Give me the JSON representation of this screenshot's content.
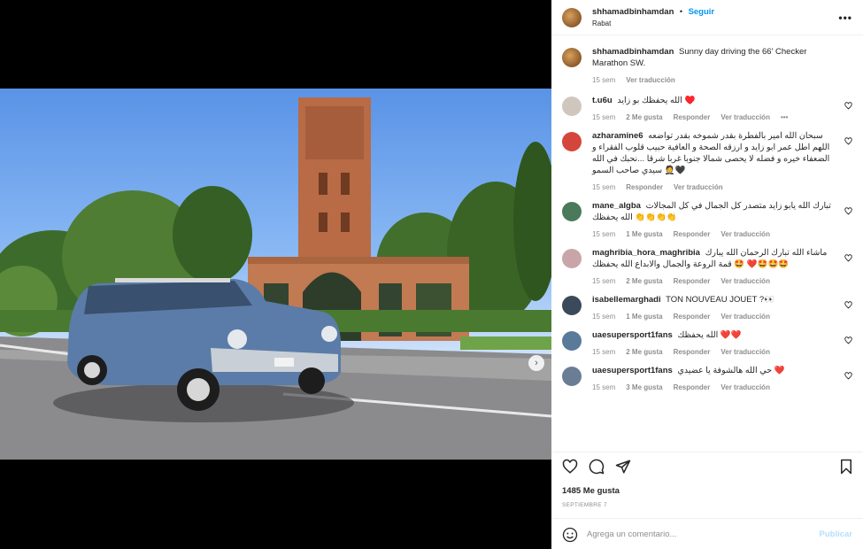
{
  "post": {
    "username": "shhamadbinhamdan",
    "separator": "•",
    "follow_label": "Seguir",
    "location": "Rabat",
    "more_label": "•••",
    "next_label": "›",
    "slide_count": 6,
    "active_slide": 1
  },
  "caption": {
    "username": "shhamadbinhamdan",
    "text": "Sunny day driving the 66' Checker Marathon SW.",
    "time": "15 sem",
    "translate": "Ver traducción"
  },
  "comments": [
    {
      "username": "t.u6u",
      "text": "الله يحفظك بو زايد ♥️",
      "time": "15 sem",
      "likes": "2 Me gusta",
      "reply": "Responder",
      "translate": "Ver traducción",
      "more": "•••",
      "rtl": false
    },
    {
      "username": "azharamine6",
      "text": "سبحان الله امير بالفطرة بقدر شموخه بقدر تواضعه اللهم اطل عمر ابو زايد و ارزقه الصحة و العافية حبيب قلوب الفقراء و الضعفاء خيره و فضله لا يحصى شمالا جنوبا غربا شرقا ...نحبك في الله سيدي صاحب السمو 🤵🖤",
      "time": "15 sem",
      "likes": "",
      "reply": "Responder",
      "translate": "Ver traducción",
      "rtl": true
    },
    {
      "username": "mane_algba",
      "text": "تبارك الله يابو زايد متصدر كل الجمال في كل المجالات الله يحفظك 👏👏👏👏",
      "time": "15 sem",
      "likes": "1 Me gusta",
      "reply": "Responder",
      "translate": "Ver traducción",
      "rtl": true
    },
    {
      "username": "maghribia_hora_maghribia",
      "text": "ماشاء الله تبارك الرحمان الله يبارك 🤩 قمة الروعة والجمال والابداع الله يحفظك ❤️🤩🤩🤩",
      "time": "15 sem",
      "likes": "2 Me gusta",
      "reply": "Responder",
      "translate": "Ver traducción",
      "rtl": true
    },
    {
      "username": "isabellemarghadi",
      "text": "TON NOUVEAU JOUET ?👀",
      "time": "15 sem",
      "likes": "1 Me gusta",
      "reply": "Responder",
      "translate": "Ver traducción",
      "rtl": false
    },
    {
      "username": "uaesupersport1fans",
      "text": "الله يحفظك ❤️❤️",
      "time": "15 sem",
      "likes": "2 Me gusta",
      "reply": "Responder",
      "translate": "Ver traducción",
      "rtl": false
    },
    {
      "username": "uaesupersport1fans",
      "text": "حي الله هالشوفة يا عضيدي ❤️",
      "time": "15 sem",
      "likes": "3 Me gusta",
      "reply": "Responder",
      "translate": "Ver traducción",
      "rtl": false
    }
  ],
  "actions": {
    "likes_count": "1485 Me gusta",
    "date": "SEPTIEMBRE 7"
  },
  "composer": {
    "placeholder": "Agrega un comentario...",
    "publish_label": "Publicar"
  },
  "colors": {
    "link": "#0095f6",
    "publish_disabled": "#b2dffc",
    "muted": "#8e8e8e",
    "text": "#262626"
  }
}
